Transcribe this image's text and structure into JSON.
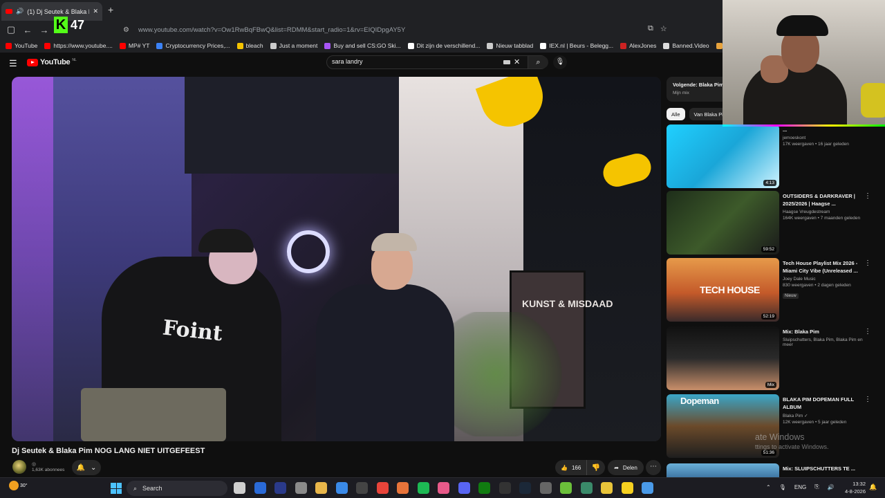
{
  "browser": {
    "tab_title": "(1) Dj Seutek & Blaka Pim N",
    "new_tab_label": "+",
    "url": "www.youtube.com/watch?v=Ow1RwBqFBwQ&list=RDMM&start_radio=1&rv=EIQIDpgAY5Y",
    "kick_count": "47",
    "bookmarks": [
      {
        "label": "YouTube",
        "color": "#ff0000"
      },
      {
        "label": "https://www.youtube....",
        "color": "#ff0000"
      },
      {
        "label": "MP# YT",
        "color": "#ff0000"
      },
      {
        "label": "Cryptocurrency Prices,...",
        "color": "#3b82f6"
      },
      {
        "label": "bleach",
        "color": "#f5c400"
      },
      {
        "label": "Just a moment",
        "color": "#cccccc"
      },
      {
        "label": "Buy and sell CS:GO Ski...",
        "color": "#a855f7"
      },
      {
        "label": "Dit zijn de verschillend...",
        "color": "#ffffff"
      },
      {
        "label": "Nieuw tabblad",
        "color": "#cccccc"
      },
      {
        "label": "IEX.nl | Beurs - Belegg...",
        "color": "#ffffff"
      },
      {
        "label": "AlexJones",
        "color": "#cc2222"
      },
      {
        "label": "Banned.Video",
        "color": "#dddddd"
      },
      {
        "label": "Niburu.co :: Onthulle",
        "color": "#e8a33d"
      }
    ]
  },
  "youtube": {
    "logo_text": "YouTube",
    "logo_region": "NL",
    "search_value": "sara landry",
    "video_title": "Dj Seutek & Blaka Pim NOG LANG NIET UITGEFEEST",
    "subscribers": "1,63K abonnees",
    "likes": "166",
    "share_label": "Delen",
    "poster_text": "KUNST & MISDAAD",
    "shirt_text": "Foint"
  },
  "sidebar": {
    "next_title": "Volgende: Blaka Pim",
    "next_sub": "Mijn mix",
    "chips": [
      "Alle",
      "Van Blaka Pim"
    ],
    "recs": [
      {
        "title": "...",
        "channel": "jemoeskont",
        "stats": "17K weergaven • 16 jaar geleden",
        "duration": "4:13",
        "badge": ""
      },
      {
        "title": "OUTSIDERS & DARKRAVER | 2025/2026 | Haagse ...",
        "channel": "Haagse Vreugdestream",
        "stats": "164K weergaven • 7 maanden geleden",
        "duration": "59:52",
        "badge": ""
      },
      {
        "title": "Tech House Playlist Mix 2026 - Miami City Vibe (Unreleased ...",
        "channel": "Joey Dale Music",
        "stats": "830 weergaven • 2 dagen geleden",
        "duration": "52:19",
        "badge": "Nieuw"
      },
      {
        "title": "Mix: Blaka Pim",
        "channel": "Sluipschutters, Blaka Pim, Blaka Pim en meer",
        "stats": "",
        "duration": "Mix",
        "badge": ""
      },
      {
        "title": "BLAKA PIM DOPEMAN FULL ALBUM",
        "channel": "Blaka Pim ✓",
        "stats": "12K weergaven • 5 jaar geleden",
        "duration": "51:36",
        "badge": ""
      },
      {
        "title": "Mix: SLUIPSCHUTTERS TE ...",
        "channel": "",
        "stats": "",
        "duration": "",
        "badge": ""
      }
    ],
    "thumb_texts": [
      "TECH HOUSE",
      "Dopeman"
    ]
  },
  "overlay": {
    "activate_line1": "ate Windows",
    "activate_line2": "ttings to activate Windows."
  },
  "taskbar": {
    "weather": "30°",
    "search_label": "Search",
    "language": "ENG",
    "time": "13:32",
    "date": "4-8-2026"
  }
}
